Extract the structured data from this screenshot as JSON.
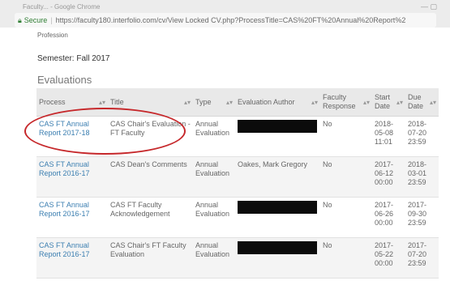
{
  "browser": {
    "tab_text": "Faculty... - Google Chrome",
    "secure_label": "Secure",
    "url": "https://faculty180.interfolio.com/cv/View Locked CV.php?ProcessTitle=CAS%20FT%20Annual%20Report%2"
  },
  "page": {
    "profession_label": "Profession",
    "semester": "Semester: Fall 2017",
    "section_title": "Evaluations"
  },
  "table": {
    "columns": [
      {
        "label": "Process"
      },
      {
        "label": "Title"
      },
      {
        "label": "Type"
      },
      {
        "label": "Evaluation Author"
      },
      {
        "label": "Faculty Response"
      },
      {
        "label": "Start Date"
      },
      {
        "label": "Due Date"
      }
    ],
    "rows": [
      {
        "process": "CAS FT Annual Report 2017-18",
        "title": "CAS Chair's Evaluation - FT Faculty",
        "type": "Annual Evaluation",
        "author": "",
        "author_redacted": true,
        "response": "No",
        "start": "2018-05-08 11:01",
        "due": "2018-07-20 23:59"
      },
      {
        "process": "CAS FT Annual Report 2016-17",
        "title": "CAS Dean's Comments",
        "type": "Annual Evaluation",
        "author": "Oakes, Mark Gregory",
        "author_redacted": false,
        "response": "No",
        "start": "2017-06-12 00:00",
        "due": "2018-03-01 23:59"
      },
      {
        "process": "CAS FT Annual Report 2016-17",
        "title": "CAS FT Faculty Acknowledgement",
        "type": "Annual Evaluation",
        "author": "",
        "author_redacted": true,
        "response": "No",
        "start": "2017-06-26 00:00",
        "due": "2017-09-30 23:59"
      },
      {
        "process": "CAS FT Annual Report 2016-17",
        "title": "CAS Chair's FT Faculty Evaluation",
        "type": "Annual Evaluation",
        "author": "",
        "author_redacted": true,
        "response": "No",
        "start": "2017-05-22 00:00",
        "due": "2017-07-20 23:59"
      }
    ]
  },
  "annotation": {
    "circle_color": "#c6282b"
  },
  "colors": {
    "link": "#3c7fb1",
    "secure": "#2e7d32",
    "header_bg": "#e9e9e9"
  }
}
